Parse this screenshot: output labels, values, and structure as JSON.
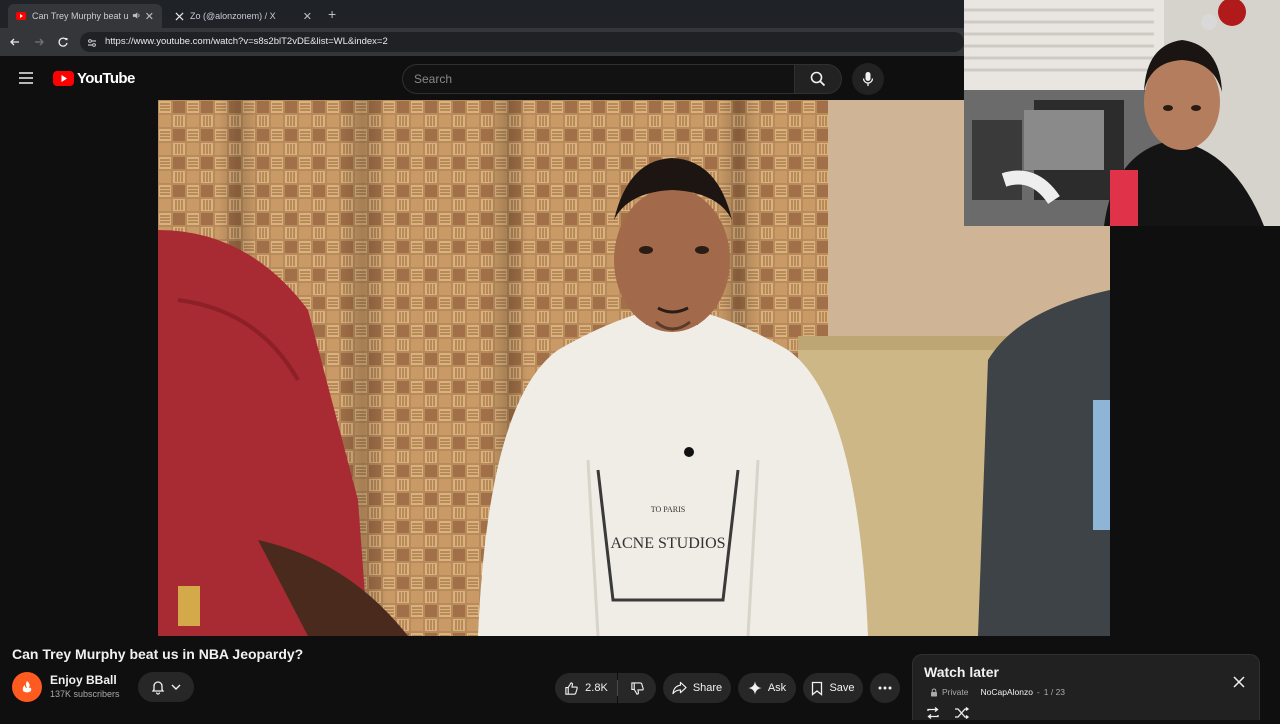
{
  "browser": {
    "tabs": [
      {
        "title": "Can Trey Murphy beat us in",
        "active": true,
        "icon": "youtube-icon"
      },
      {
        "title": "Zo (@alonzonem) / X",
        "active": false,
        "icon": "x-logo-icon"
      }
    ],
    "url": "https://www.youtube.com/watch?v=s8s2blT2vDE&list=WL&index=2"
  },
  "youtube": {
    "logo_text": "YouTube",
    "search_placeholder": "Search"
  },
  "video": {
    "title": "Can Trey Murphy beat us in NBA Jeopardy?",
    "shirt_text": "ACNE STUDIOS",
    "shirt_small": "TO PARIS"
  },
  "channel": {
    "name": "Enjoy BBall",
    "subscribers": "137K subscribers"
  },
  "actions": {
    "likes": "2.8K",
    "share": "Share",
    "ask": "Ask",
    "save": "Save"
  },
  "playlist": {
    "title": "Watch later",
    "privacy": "Private",
    "owner": "NoCapAlonzo",
    "position": "1 / 23"
  },
  "colors": {
    "youtube_red": "#ff0000",
    "background": "#0f0f0f",
    "channel_avatar": "#ff5a1f"
  }
}
